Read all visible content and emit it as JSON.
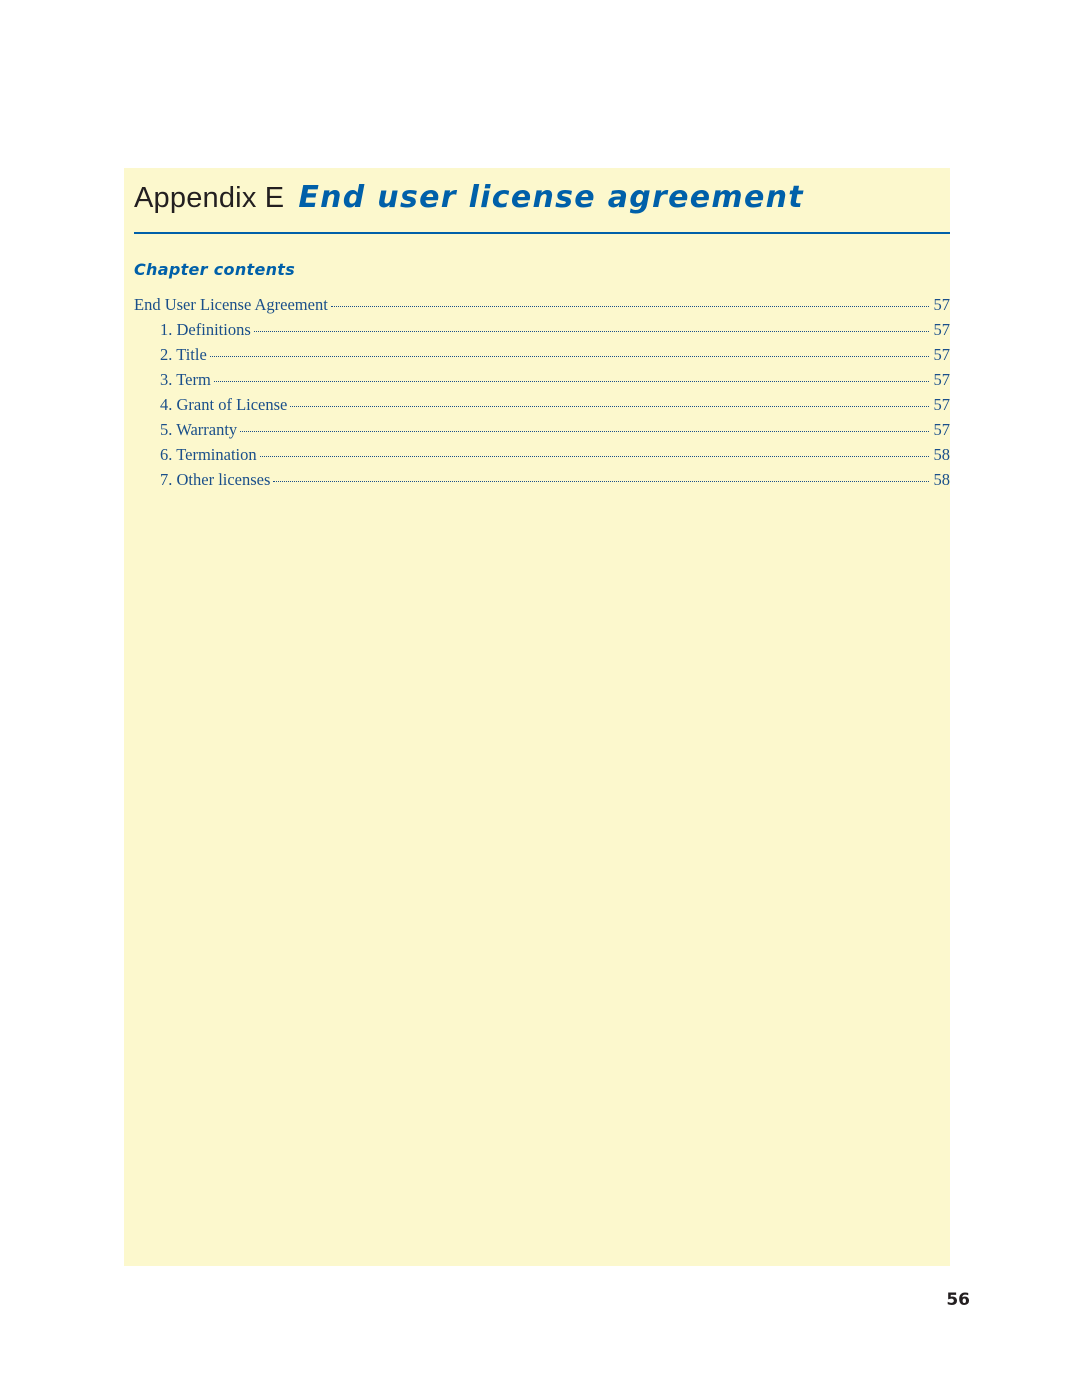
{
  "document": {
    "appendix_label": "Appendix E",
    "appendix_title": "End user license agreement",
    "chapter_contents_heading": "Chapter contents",
    "folio": "56",
    "accent_color": "#0060a9",
    "panel_color": "#fcf8cd",
    "toc_text_color": "#1a4f8a"
  },
  "toc": [
    {
      "label": "End User License Agreement",
      "page": "57",
      "level": 0
    },
    {
      "label": "1. Definitions",
      "page": "57",
      "level": 1
    },
    {
      "label": "2. Title",
      "page": "57",
      "level": 1
    },
    {
      "label": "3. Term",
      "page": "57",
      "level": 1
    },
    {
      "label": "4. Grant of License",
      "page": "57",
      "level": 1
    },
    {
      "label": "5. Warranty",
      "page": "57",
      "level": 1
    },
    {
      "label": "6. Termination",
      "page": "58",
      "level": 1
    },
    {
      "label": "7. Other licenses",
      "page": "58",
      "level": 1
    }
  ]
}
